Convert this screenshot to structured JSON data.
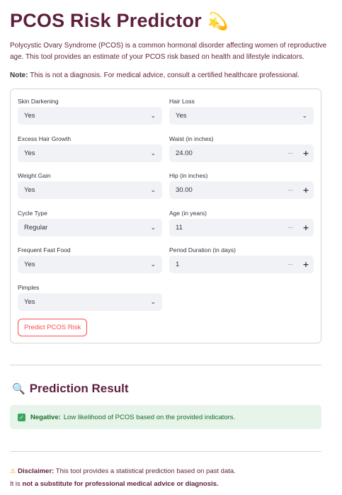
{
  "page": {
    "title": "PCOS Risk Predictor",
    "title_emoji": "💫",
    "intro": "Polycystic Ovary Syndrome (PCOS) is a common hormonal disorder affecting women of reproductive age. This tool provides an estimate of your PCOS risk based on health and lifestyle indicators.",
    "note_label": "Note:",
    "note_text": " This is not a diagnosis. For medical advice, consult a certified healthcare professional."
  },
  "form": {
    "skin_darkening": {
      "label": "Skin Darkening",
      "value": "Yes"
    },
    "hair_loss": {
      "label": "Hair Loss",
      "value": "Yes"
    },
    "excess_hair": {
      "label": "Excess Hair Growth",
      "value": "Yes"
    },
    "waist": {
      "label": "Waist (in inches)",
      "value": "24.00"
    },
    "weight_gain": {
      "label": "Weight Gain",
      "value": "Yes"
    },
    "hip": {
      "label": "Hip (in inches)",
      "value": "30.00"
    },
    "cycle_type": {
      "label": "Cycle Type",
      "value": "Regular"
    },
    "age": {
      "label": "Age (in years)",
      "value": "11"
    },
    "fast_food": {
      "label": "Frequent Fast Food",
      "value": "Yes"
    },
    "period_duration": {
      "label": "Period Duration (in days)",
      "value": "1"
    },
    "pimples": {
      "label": "Pimples",
      "value": "Yes"
    },
    "submit_label": "Predict PCOS Risk",
    "stepper_minus": "−",
    "stepper_plus": "+"
  },
  "result": {
    "heading": "Prediction Result",
    "status_label": "Negative:",
    "status_text": " Low likelihood of PCOS based on the provided indicators."
  },
  "disclaimer": {
    "label": "Disclaimer:",
    "text1": " This tool provides a statistical prediction based on past data.",
    "text2_prefix": "It is ",
    "text2_bold": "not a substitute for professional medical advice or diagnosis."
  },
  "colors": {
    "heading": "#5e1f3d",
    "accent": "#ff4b4b",
    "success_bg": "#e6f4ea",
    "success_text": "#1d6b2a"
  },
  "icons": {
    "title": "dizzy-star-icon",
    "result": "magnifier-icon",
    "success": "check-box-icon",
    "warning": "warning-icon"
  }
}
